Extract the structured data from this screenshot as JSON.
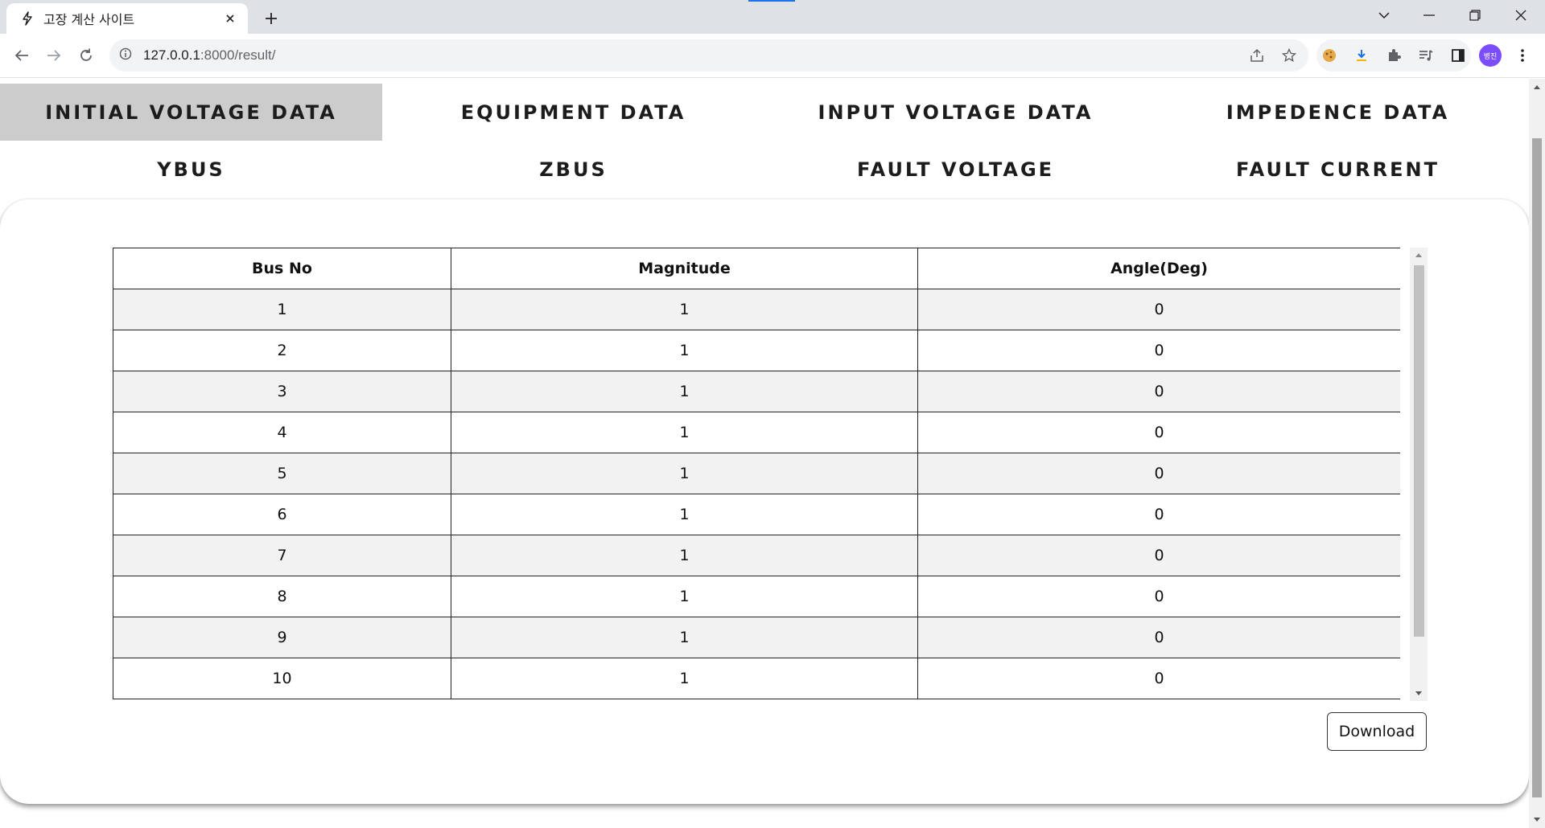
{
  "browser": {
    "tab_title": "고장 계산 사이트",
    "url_host": "127.0.0.1",
    "url_path": ":8000/result/",
    "avatar_text": "병진"
  },
  "nav": {
    "row1": [
      {
        "label": "INITIAL VOLTAGE DATA",
        "active": true
      },
      {
        "label": "EQUIPMENT DATA",
        "active": false
      },
      {
        "label": "INPUT VOLTAGE DATA",
        "active": false
      },
      {
        "label": "IMPEDENCE DATA",
        "active": false
      }
    ],
    "row2": [
      {
        "label": "YBUS",
        "active": false
      },
      {
        "label": "ZBUS",
        "active": false
      },
      {
        "label": "FAULT VOLTAGE",
        "active": false
      },
      {
        "label": "FAULT CURRENT",
        "active": false
      }
    ]
  },
  "table": {
    "headers": [
      "Bus No",
      "Magnitude",
      "Angle(Deg)"
    ],
    "rows": [
      [
        "1",
        "1",
        "0"
      ],
      [
        "2",
        "1",
        "0"
      ],
      [
        "3",
        "1",
        "0"
      ],
      [
        "4",
        "1",
        "0"
      ],
      [
        "5",
        "1",
        "0"
      ],
      [
        "6",
        "1",
        "0"
      ],
      [
        "7",
        "1",
        "0"
      ],
      [
        "8",
        "1",
        "0"
      ],
      [
        "9",
        "1",
        "0"
      ],
      [
        "10",
        "1",
        "0"
      ]
    ]
  },
  "actions": {
    "download_label": "Download"
  },
  "colors": {
    "active_tab_bg": "#cccccc",
    "striped_row_bg": "#f2f2f2",
    "avatar_bg": "#7c4dff"
  }
}
